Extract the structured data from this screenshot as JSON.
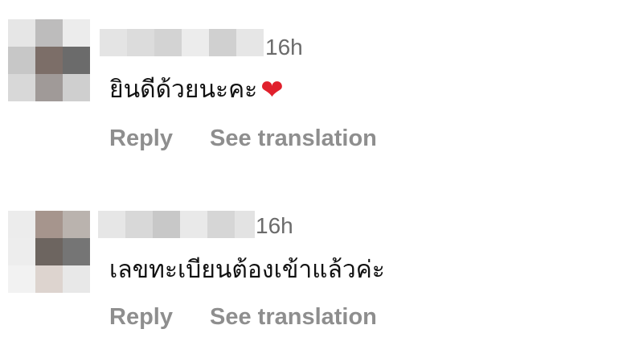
{
  "comments": [
    {
      "time": "16h",
      "text": "ยินดีด้วยนะคะ",
      "emoji": "❤️",
      "reply_label": "Reply",
      "translate_label": "See translation"
    },
    {
      "time": "16h",
      "text": "เลขทะเบียนต้องเข้าแล้วค่ะ",
      "reply_label": "Reply",
      "translate_label": "See translation"
    }
  ]
}
